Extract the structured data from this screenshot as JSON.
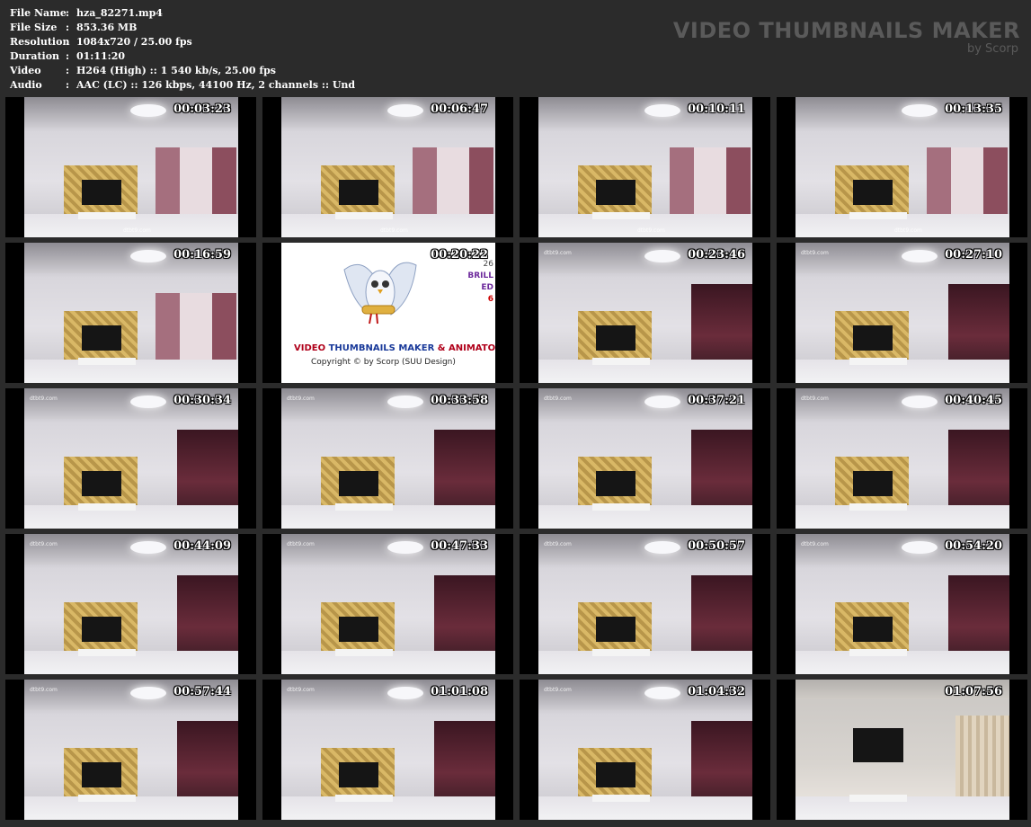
{
  "info": [
    {
      "label": "File Name",
      "value": "hza_82271.mp4"
    },
    {
      "label": "File Size",
      "value": "853.36 MB"
    },
    {
      "label": "Resolution",
      "value": "1084x720 / 25.00 fps"
    },
    {
      "label": "Duration",
      "value": "01:11:20"
    },
    {
      "label": "Video",
      "value": "H264 (High) :: 1 540 kb/s, 25.00 fps"
    },
    {
      "label": "Audio",
      "value": "AAC (LC) :: 126 kbps, 44100 Hz, 2 channels :: Und"
    }
  ],
  "separator": ":",
  "brand": {
    "title": "VIDEO THUMBNAILS MAKER",
    "subtitle": "by Scorp"
  },
  "thumbnails": [
    {
      "timestamp": "00:03:23",
      "scene": "bright",
      "watermark": "dtbt9.com"
    },
    {
      "timestamp": "00:06:47",
      "scene": "bright",
      "watermark": "dtbt9.com"
    },
    {
      "timestamp": "00:10:11",
      "scene": "bright",
      "watermark": "dtbt9.com"
    },
    {
      "timestamp": "00:13:35",
      "scene": "bright",
      "watermark": "dtbt9.com"
    },
    {
      "timestamp": "00:16:59",
      "scene": "bright",
      "watermark": ""
    },
    {
      "timestamp": "00:20:22",
      "scene": "logo",
      "watermark": ""
    },
    {
      "timestamp": "00:23:46",
      "scene": "dark",
      "watermark": "dtbt9.com"
    },
    {
      "timestamp": "00:27:10",
      "scene": "dark",
      "watermark": "dtbt9.com"
    },
    {
      "timestamp": "00:30:34",
      "scene": "dark",
      "watermark": "dtbt9.com"
    },
    {
      "timestamp": "00:33:58",
      "scene": "dark",
      "watermark": "dtbt9.com"
    },
    {
      "timestamp": "00:37:21",
      "scene": "dark",
      "watermark": "dtbt9.com"
    },
    {
      "timestamp": "00:40:45",
      "scene": "dark",
      "watermark": "dtbt9.com"
    },
    {
      "timestamp": "00:44:09",
      "scene": "dark",
      "watermark": "dtbt9.com"
    },
    {
      "timestamp": "00:47:33",
      "scene": "dark",
      "watermark": "dtbt9.com"
    },
    {
      "timestamp": "00:50:57",
      "scene": "dark",
      "watermark": "dtbt9.com"
    },
    {
      "timestamp": "00:54:20",
      "scene": "dark",
      "watermark": "dtbt9.com"
    },
    {
      "timestamp": "00:57:44",
      "scene": "dark",
      "watermark": "dtbt9.com"
    },
    {
      "timestamp": "01:01:08",
      "scene": "dark",
      "watermark": "dtbt9.com"
    },
    {
      "timestamp": "01:04:32",
      "scene": "dark",
      "watermark": "dtbt9.com"
    },
    {
      "timestamp": "01:07:56",
      "scene": "room2",
      "watermark": ""
    }
  ],
  "logo": {
    "title_a": "VIDEO ",
    "title_b": "THUMBNAILS MAKER",
    "title_c": " & ANIMATOR",
    "copyright": "Copyright © by Scorp (SUU Design)",
    "right_lines": [
      "26",
      "BRILL",
      "ED",
      "6"
    ]
  }
}
